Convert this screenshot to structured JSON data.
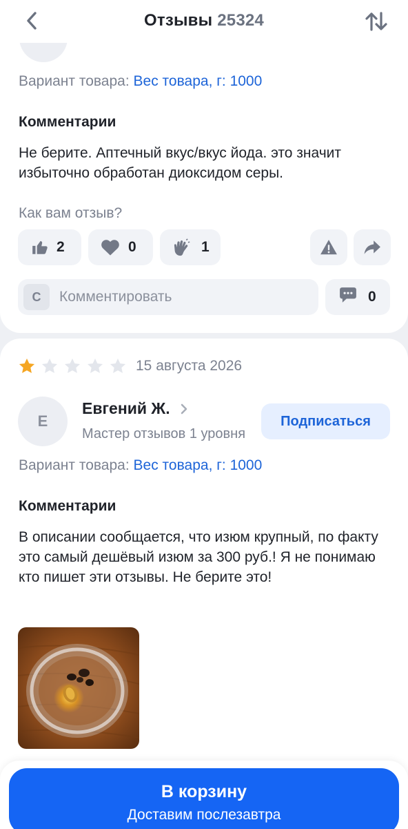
{
  "header": {
    "title": "Отзывы",
    "count": "25324"
  },
  "review1": {
    "variant_label": "Вариант товара:",
    "variant_value": "Вес товара, г: 1000",
    "comments_title": "Комментарии",
    "comment_text": "Не берите. Аптечный вкус/вкус йода. это значит избыточно обработан диоксидом серы.",
    "rate_question": "Как вам отзыв?",
    "reactions": {
      "like": "2",
      "heart": "0",
      "clap": "1"
    },
    "comment_input": {
      "avatar_letter": "С",
      "placeholder": "Комментировать"
    },
    "comments_count": "0"
  },
  "review2": {
    "rating": 1,
    "max_rating": 5,
    "date": "15 августа 2026",
    "author_initial": "Е",
    "author_name": "Евгений Ж.",
    "author_level": "Мастер отзывов 1 уровня",
    "subscribe_label": "Подписаться",
    "variant_label": "Вариант товара:",
    "variant_value": "Вес товара, г: 1000",
    "comments_title": "Комментарии",
    "comment_text": "В описании сообщается, что изюм крупный, по факту это самый дешёвый изюм за 300 руб.! Я не понимаю кто пишет эти отзывы. Не берите это!"
  },
  "cart": {
    "label": "В корзину",
    "sublabel": "Доставим послезавтра"
  },
  "colors": {
    "accent": "#1565f4",
    "link": "#1d64d8",
    "star_filled": "#f5a623",
    "star_empty": "#e3e6ec"
  },
  "icons": [
    "back-arrow-icon",
    "sort-icon",
    "thumbs-up-icon",
    "heart-icon",
    "clap-icon",
    "warning-icon",
    "share-icon",
    "comment-bubble-icon",
    "star-icon",
    "chevron-right-icon"
  ]
}
